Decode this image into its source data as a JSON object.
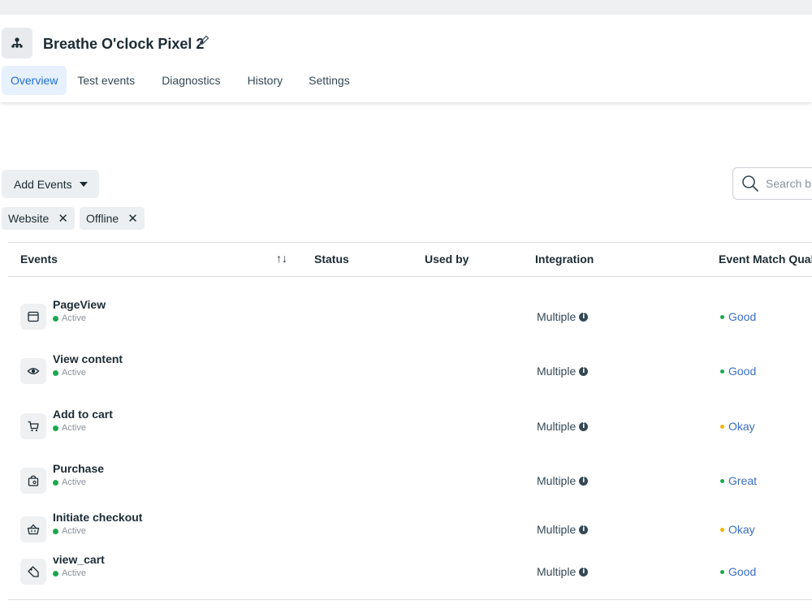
{
  "header": {
    "title": "Breathe O'clock Pixel 2",
    "tabs": [
      "Overview",
      "Test events",
      "Diagnostics",
      "History",
      "Settings"
    ],
    "active_tab": "Overview"
  },
  "toolbar": {
    "add_events_label": "Add Events",
    "search_placeholder": "Search b"
  },
  "filters": [
    "Website",
    "Offline"
  ],
  "table": {
    "columns": [
      "Events",
      "Status",
      "Used by",
      "Integration",
      "Event Match Qualit"
    ],
    "sort_icon": "↑↓",
    "rows": [
      {
        "icon": "browser-window-icon",
        "name": "PageView",
        "status": "Active",
        "integration": "Multiple",
        "emq": "Good",
        "emq_color": "#19a84f"
      },
      {
        "icon": "eye-icon",
        "name": "View content",
        "status": "Active",
        "integration": "Multiple",
        "emq": "Good",
        "emq_color": "#19a84f"
      },
      {
        "icon": "cart-icon",
        "name": "Add to cart",
        "status": "Active",
        "integration": "Multiple",
        "emq": "Okay",
        "emq_color": "#f2b50a"
      },
      {
        "icon": "shopping-bag-icon",
        "name": "Purchase",
        "status": "Active",
        "integration": "Multiple",
        "emq": "Great",
        "emq_color": "#19a84f"
      },
      {
        "icon": "basket-icon",
        "name": "Initiate checkout",
        "status": "Active",
        "integration": "Multiple",
        "emq": "Okay",
        "emq_color": "#f2b50a"
      },
      {
        "icon": "tag-icon",
        "name": "view_cart",
        "status": "Active",
        "integration": "Multiple",
        "emq": "Good",
        "emq_color": "#19a84f"
      }
    ]
  },
  "colors": {
    "accent": "#1d6fd8",
    "active_green": "#19a84f",
    "okay_yellow": "#f2b50a",
    "quality_text": "#3a6fc4"
  }
}
